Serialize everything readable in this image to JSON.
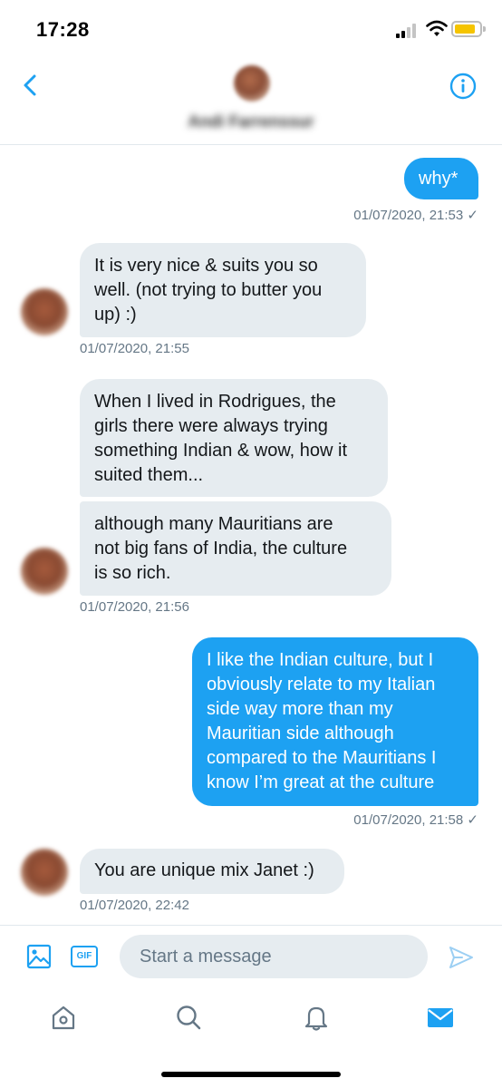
{
  "status_bar": {
    "time": "17:28"
  },
  "header": {
    "name": "Andi Farrenssur"
  },
  "messages": [
    {
      "text": "why*",
      "timestamp": "01/07/2020, 21:53"
    },
    {
      "text": "It is very nice & suits you so\nwell. (not trying to butter you\nup) :)",
      "timestamp": "01/07/2020, 21:55"
    },
    {
      "text": "When I lived in Rodrigues, the\ngirls there were always trying\nsomething Indian & wow, how it\nsuited them..."
    },
    {
      "text": "although many Mauritians are\nnot big fans of India, the culture\nis so rich.",
      "timestamp": "01/07/2020, 21:56"
    },
    {
      "text": "I like the Indian culture, but I\nobviously relate to my Italian\nside way more than my\nMauritian side although\ncompared to the Mauritians I\nknow I’m great at the culture",
      "timestamp": "01/07/2020, 21:58"
    },
    {
      "text": "You are unique mix Janet :)",
      "timestamp": "01/07/2020, 22:42"
    }
  ],
  "composer": {
    "placeholder": "Start a message",
    "gif_label": "GIF"
  },
  "icons": {
    "back": "chevron-left-icon",
    "info": "info-icon",
    "image": "image-icon",
    "send": "send-icon",
    "tabs": [
      "home-icon",
      "search-icon",
      "bell-icon",
      "mail-icon"
    ]
  },
  "colors": {
    "accent": "#1da1f2",
    "incoming_bubble": "#e6ecf0",
    "muted_text": "#657786",
    "battery": "#f5c400"
  },
  "battery_level": 0.85
}
